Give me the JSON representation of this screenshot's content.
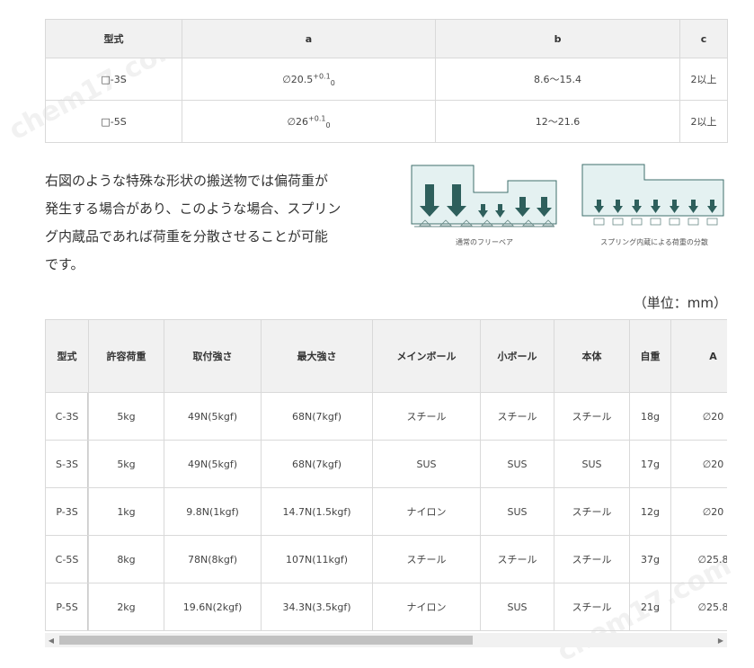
{
  "spec_table": {
    "headers": [
      "型式",
      "a",
      "b",
      "c"
    ],
    "rows": [
      {
        "model": "□-3S",
        "a_base": "∅20.5",
        "a_sup": "+0.1",
        "a_sub": "0",
        "b": "8.6〜15.4",
        "c": "2以上"
      },
      {
        "model": "□-5S",
        "a_base": "∅26",
        "a_sup": "+0.1",
        "a_sub": "0",
        "b": "12〜21.6",
        "c": "2以上"
      }
    ]
  },
  "description": {
    "lines": [
      "右図のような特殊な形状の搬送物では偏荷重が",
      "発生する場合があり、このような場合、スプリン",
      "グ内蔵品であれば荷重を分散させることが可能",
      "です。"
    ]
  },
  "figures": {
    "left_caption": "通常のフリーベア",
    "right_caption": "スプリング内蔵による荷重の分散"
  },
  "unit_label": "（単位：mm）",
  "main_table": {
    "headers": [
      "型式",
      "許容荷重",
      "取付強さ",
      "最大強さ",
      "メインボール",
      "小ボール",
      "本体",
      "自重",
      "A"
    ],
    "rows": [
      [
        "C-3S",
        "5kg",
        "49N(5kgf)",
        "68N(7kgf)",
        "スチール",
        "スチール",
        "スチール",
        "18g",
        "∅20"
      ],
      [
        "S-3S",
        "5kg",
        "49N(5kgf)",
        "68N(7kgf)",
        "SUS",
        "SUS",
        "SUS",
        "17g",
        "∅20"
      ],
      [
        "P-3S",
        "1kg",
        "9.8N(1kgf)",
        "14.7N(1.5kgf)",
        "ナイロン",
        "SUS",
        "スチール",
        "12g",
        "∅20"
      ],
      [
        "C-5S",
        "8kg",
        "78N(8kgf)",
        "107N(11kgf)",
        "スチール",
        "スチール",
        "スチール",
        "37g",
        "∅25.8"
      ],
      [
        "P-5S",
        "2kg",
        "19.6N(2kgf)",
        "34.3N(3.5kgf)",
        "ナイロン",
        "SUS",
        "スチール",
        "21g",
        "∅25.8"
      ]
    ]
  },
  "watermark": "chem17.com",
  "colors": {
    "arrow": "#2e5f5c",
    "panel": "#e4f1f1",
    "panel_border": "#3f6f6c"
  }
}
